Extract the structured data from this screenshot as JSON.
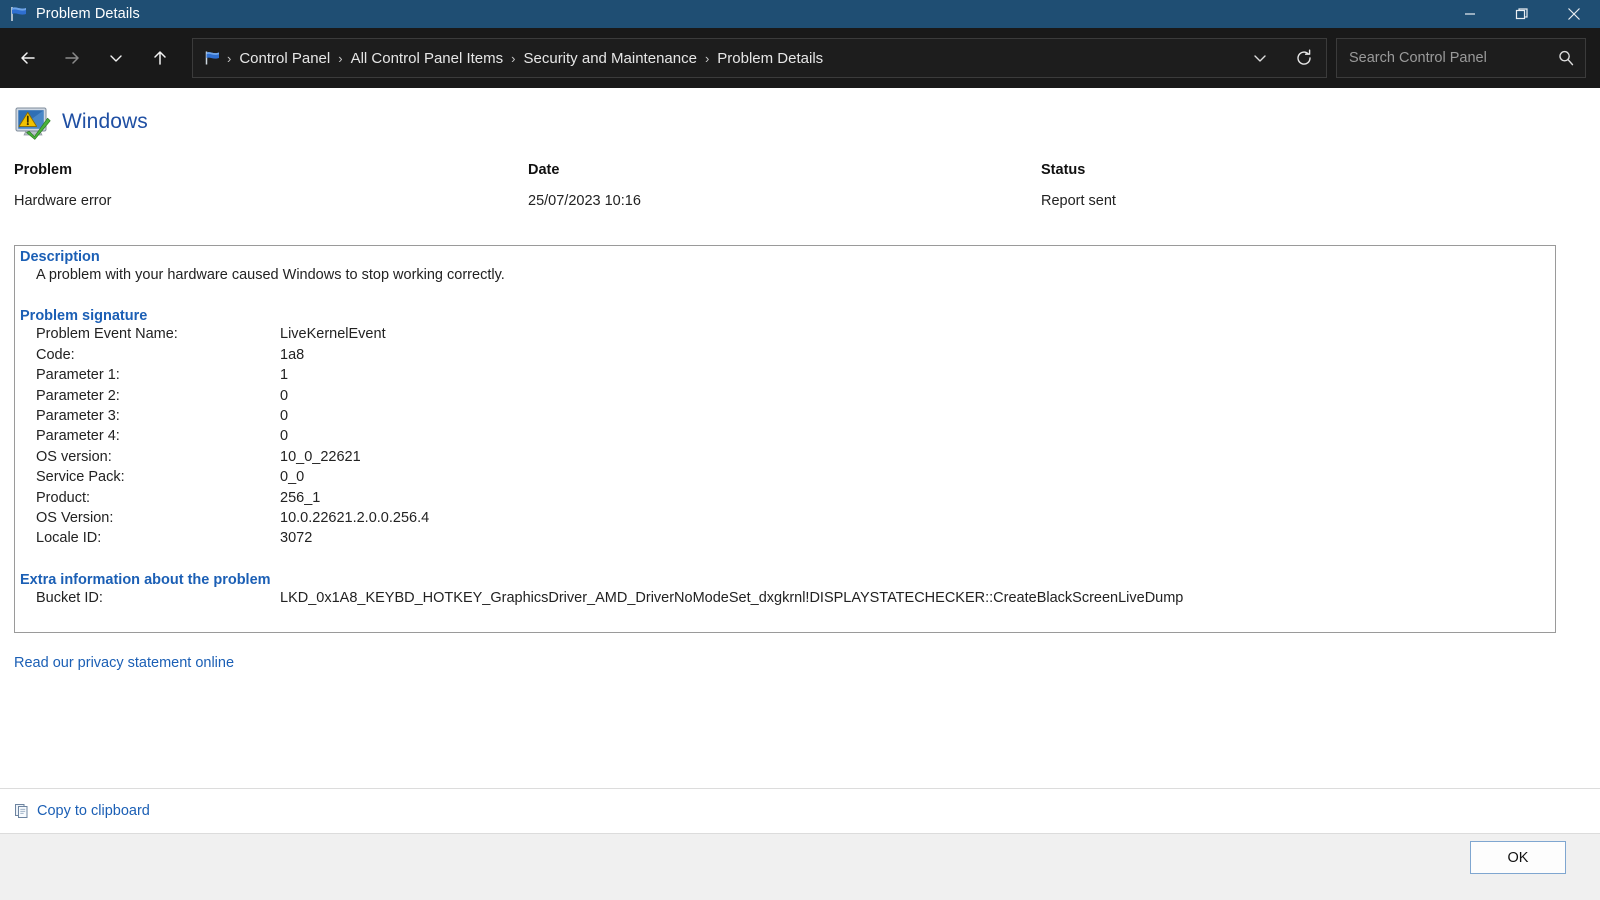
{
  "window": {
    "title": "Problem Details",
    "icon": "flag-icon",
    "controls": {
      "minimize": "minimize-icon",
      "maximize": "restore-icon",
      "close": "close-icon"
    }
  },
  "nav": {
    "back": "back-arrow-icon",
    "forward": "forward-arrow-icon",
    "recent": "chevron-down-icon",
    "up": "up-arrow-icon",
    "history_dropdown": "chevron-down-icon",
    "refresh": "refresh-icon",
    "breadcrumb_icon": "flag-icon",
    "breadcrumbs": [
      "Control Panel",
      "All Control Panel Items",
      "Security and Maintenance",
      "Problem Details"
    ],
    "separator": "›"
  },
  "search": {
    "placeholder": "Search Control Panel",
    "value": "",
    "icon": "search-icon"
  },
  "page": {
    "app_icon": "windows-problem-icon",
    "app_title": "Windows",
    "columns": [
      {
        "header": "Problem",
        "value": "Hardware error"
      },
      {
        "header": "Date",
        "value": "25/07/2023 10:16"
      },
      {
        "header": "Status",
        "value": "Report sent"
      }
    ],
    "description": {
      "title": "Description",
      "text": "A problem with your hardware caused Windows to stop working correctly."
    },
    "problem_signature": {
      "title": "Problem signature",
      "rows": [
        {
          "label": "Problem Event Name:",
          "value": "LiveKernelEvent"
        },
        {
          "label": "Code:",
          "value": "1a8"
        },
        {
          "label": "Parameter 1:",
          "value": "1"
        },
        {
          "label": "Parameter 2:",
          "value": "0"
        },
        {
          "label": "Parameter 3:",
          "value": "0"
        },
        {
          "label": "Parameter 4:",
          "value": "0"
        },
        {
          "label": "OS version:",
          "value": "10_0_22621"
        },
        {
          "label": "Service Pack:",
          "value": "0_0"
        },
        {
          "label": "Product:",
          "value": "256_1"
        },
        {
          "label": "OS Version:",
          "value": "10.0.22621.2.0.0.256.4"
        },
        {
          "label": "Locale ID:",
          "value": "3072"
        }
      ]
    },
    "extra_information": {
      "title": "Extra information about the problem",
      "rows": [
        {
          "label": "Bucket ID:",
          "value": "LKD_0x1A8_KEYBD_HOTKEY_GraphicsDriver_AMD_DriverNoModeSet_dxgkrnl!DISPLAYSTATECHECKER::CreateBlackScreenLiveDump"
        }
      ]
    },
    "privacy_link": "Read our privacy statement online",
    "copy_link": "Copy to clipboard",
    "copy_icon": "copy-icon"
  },
  "footer": {
    "ok_label": "OK"
  },
  "colors": {
    "titlebar": "#1f4e73",
    "navbar": "#191919",
    "link": "#1b5fb5",
    "app_title": "#1f4fa3",
    "footer": "#f0f0f0"
  }
}
